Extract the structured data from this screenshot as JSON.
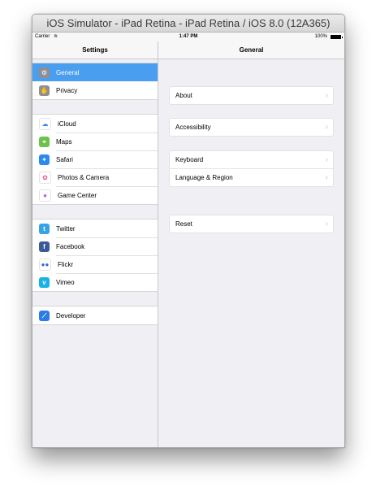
{
  "window": {
    "title": "iOS Simulator - iPad Retina - iPad Retina / iOS 8.0 (12A365)"
  },
  "status_bar": {
    "carrier": "Carrier",
    "time": "1:47 PM",
    "battery": "100%"
  },
  "master": {
    "title": "Settings",
    "groups": [
      [
        {
          "label": "General",
          "icon": "gear-icon",
          "color": "#8e8e93",
          "glyph": "⚙",
          "selected": true
        },
        {
          "label": "Privacy",
          "icon": "hand-icon",
          "color": "#8e8e93",
          "glyph": "✋"
        }
      ],
      [
        {
          "label": "iCloud",
          "icon": "cloud-icon",
          "color": "#ffffff",
          "glyph": "☁",
          "glyph_color": "#2f8fe8"
        },
        {
          "label": "Maps",
          "icon": "maps-icon",
          "color": "#6cc24a",
          "glyph": "⌖"
        },
        {
          "label": "Safari",
          "icon": "compass-icon",
          "color": "#2a8af0",
          "glyph": "✦"
        },
        {
          "label": "Photos & Camera",
          "icon": "photos-icon",
          "color": "#ffffff",
          "glyph": "✿",
          "glyph_color": "#f04a7a"
        },
        {
          "label": "Game Center",
          "icon": "game-center-icon",
          "color": "#ffffff",
          "glyph": "●",
          "glyph_color": "#b05cf0"
        }
      ],
      [
        {
          "label": "Twitter",
          "icon": "twitter-icon",
          "color": "#35a3e6",
          "glyph": "t"
        },
        {
          "label": "Facebook",
          "icon": "facebook-icon",
          "color": "#3b5998",
          "glyph": "f"
        },
        {
          "label": "Flickr",
          "icon": "flickr-icon",
          "color": "#ffffff",
          "glyph": "●●",
          "glyph_color": "#2a6ad8"
        },
        {
          "label": "Vimeo",
          "icon": "vimeo-icon",
          "color": "#19b2e6",
          "glyph": "v"
        }
      ],
      [
        {
          "label": "Developer",
          "icon": "hammer-icon",
          "color": "#2a7ae8",
          "glyph": "⟋"
        }
      ]
    ]
  },
  "detail": {
    "title": "General",
    "groups": [
      [
        "About"
      ],
      [
        "Accessibility"
      ],
      [
        "Keyboard",
        "Language & Region"
      ],
      [
        "Reset"
      ]
    ]
  }
}
